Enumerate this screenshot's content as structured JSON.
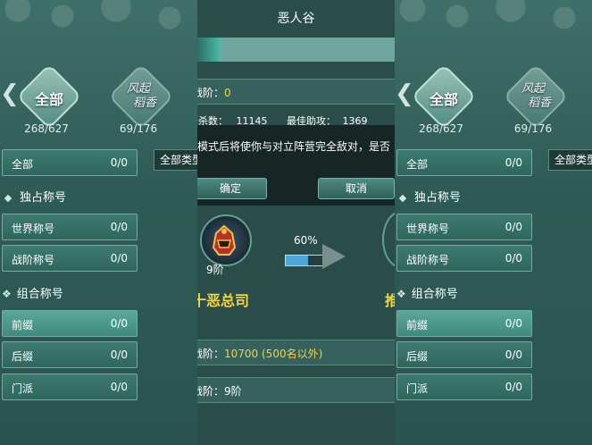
{
  "left": {
    "all_label": "全部",
    "fengqi_line1": "风起",
    "fengqi_line2": "稻香",
    "count_all": "268/627",
    "count_fengqi": "69/176",
    "dropdown": "全部类型",
    "rows": {
      "all": {
        "label": "全部",
        "value": "0/0"
      },
      "world": {
        "label": "世界称号",
        "value": "0/0"
      },
      "battle": {
        "label": "战阶称号",
        "value": "0/0"
      },
      "prefix": {
        "label": "前缀",
        "value": "0/0"
      },
      "suffix": {
        "label": "后缀",
        "value": "0/0"
      },
      "sect": {
        "label": "门派",
        "value": "0/0"
      }
    },
    "section_exclusive": "独占称号",
    "section_combo": "组合称号"
  },
  "center": {
    "title": "恶人谷",
    "progress_fraction": 0.12,
    "rank_label": "战阶：",
    "rank_value": "0",
    "kills_label": "击杀数：",
    "kills_value": "11145",
    "best_assist_label": "最佳助攻：",
    "best_assist_value": "1369",
    "dialog_text": "开启模式后将使你与对立阵营完全敌对，是否",
    "confirm": "确定",
    "cancel": "取消",
    "helmet_rank": "9阶",
    "percent": "60%",
    "percent_value": 0.6,
    "faction_name": "十恶总司",
    "right_partial": "推",
    "weekly_label": "战阶：",
    "weekly_value": "10700 (500名以外)",
    "bottom_label": "战阶：",
    "bottom_value": "9阶"
  }
}
